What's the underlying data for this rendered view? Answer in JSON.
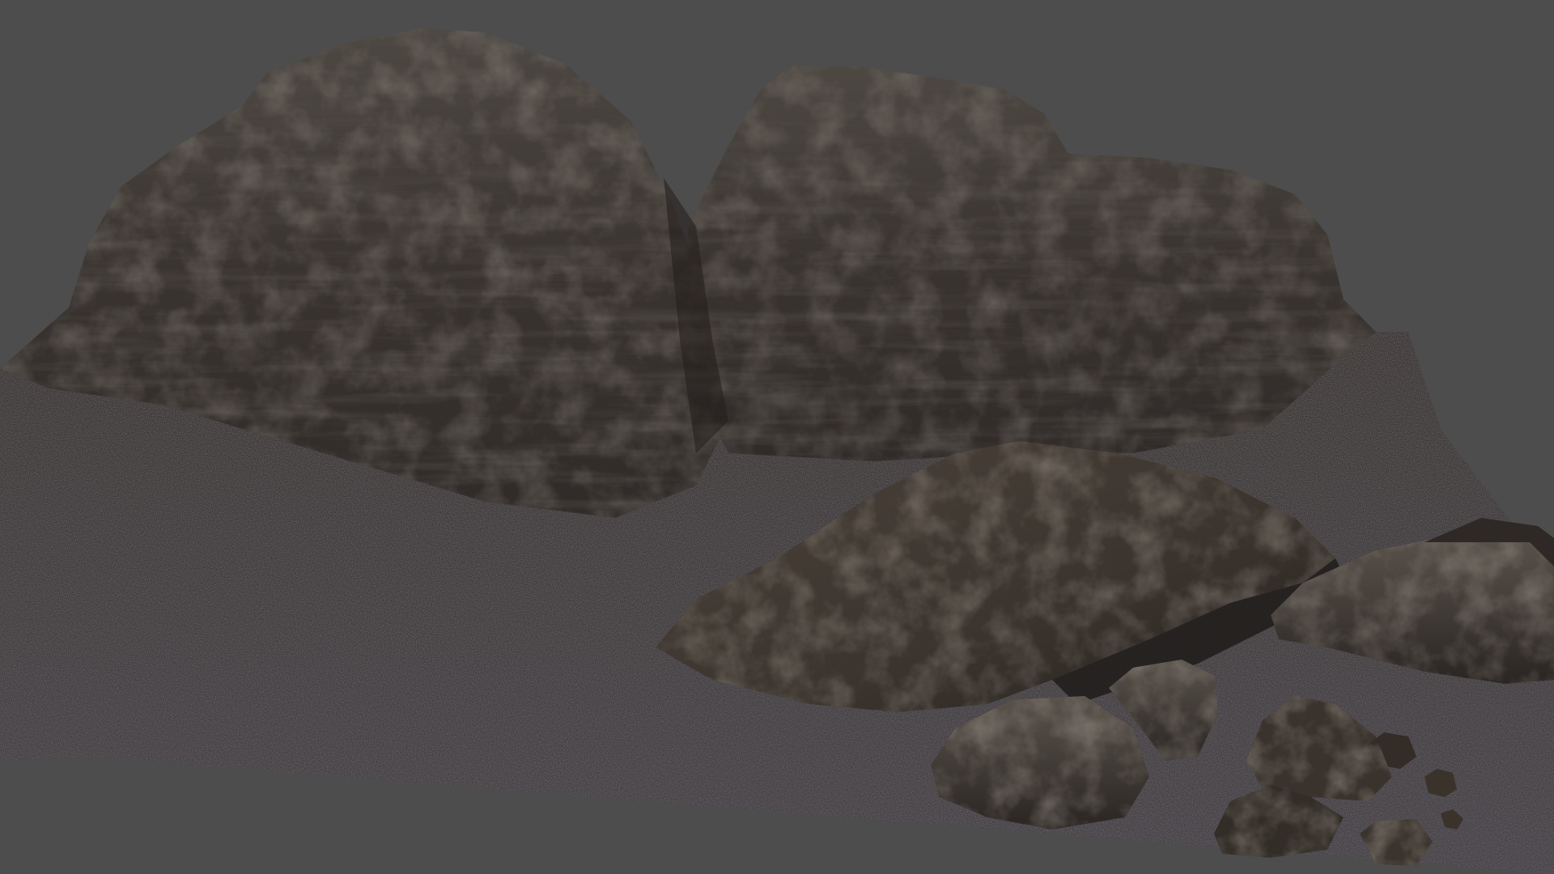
{
  "scene": {
    "background_color": "#4d4d4d",
    "ground_color": "#3f3b3e",
    "rock_dark_color": "#2d2825",
    "rock_mid_color": "#4a433d",
    "rock_highlight_color": "#7d7468",
    "subject": "rock-formation-3d-render",
    "objects": [
      "left-cliff",
      "right-cliff",
      "slab-rock",
      "right-boulder",
      "small-boulder-1",
      "small-boulder-2",
      "pebble-cluster"
    ]
  }
}
